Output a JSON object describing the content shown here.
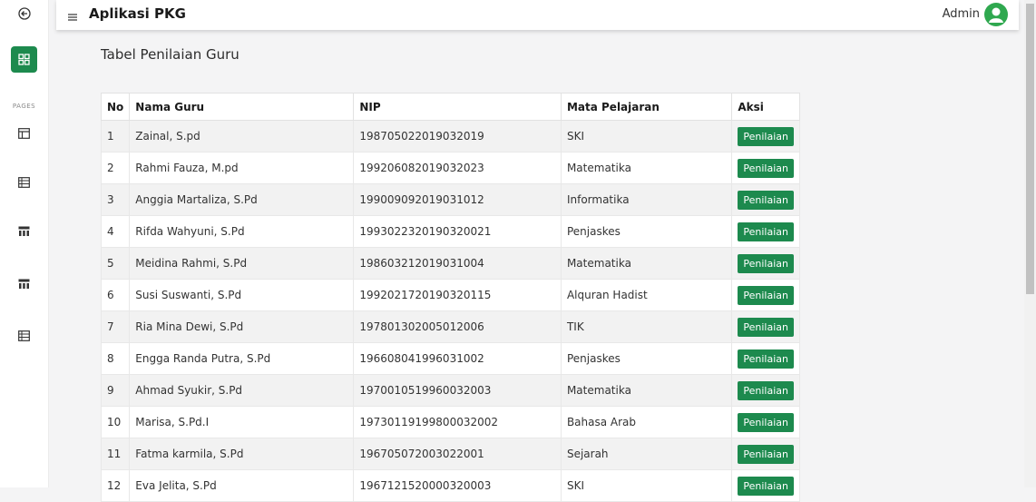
{
  "app": {
    "title": "Aplikasi PKG"
  },
  "header": {
    "user_label": "Admin"
  },
  "sidebar": {
    "section_label": "PAGES"
  },
  "page": {
    "heading": "Tabel Penilaian Guru"
  },
  "table": {
    "columns": [
      "No",
      "Nama Guru",
      "NIP",
      "Mata Pelajaran",
      "Aksi"
    ],
    "rows": [
      {
        "no": "1",
        "nama": "Zainal, S.pd",
        "nip": "198705022019032019",
        "mapel": "SKI",
        "aksi": "Penilaian"
      },
      {
        "no": "2",
        "nama": "Rahmi Fauza, M.pd",
        "nip": "199206082019032023",
        "mapel": "Matematika",
        "aksi": "Penilaian"
      },
      {
        "no": "3",
        "nama": "Anggia Martaliza, S.Pd",
        "nip": "199009092019031012",
        "mapel": "Informatika",
        "aksi": "Penilaian"
      },
      {
        "no": "4",
        "nama": "Rifda Wahyuni, S.Pd",
        "nip": "1993022320190320021",
        "mapel": "Penjaskes",
        "aksi": "Penilaian"
      },
      {
        "no": "5",
        "nama": "Meidina Rahmi, S.Pd",
        "nip": "198603212019031004",
        "mapel": "Matematika",
        "aksi": "Penilaian"
      },
      {
        "no": "6",
        "nama": "Susi Suswanti, S.Pd",
        "nip": "1992021720190320115",
        "mapel": "Alquran Hadist",
        "aksi": "Penilaian"
      },
      {
        "no": "7",
        "nama": "Ria Mina Dewi, S.Pd",
        "nip": "197801302005012006",
        "mapel": "TIK",
        "aksi": "Penilaian"
      },
      {
        "no": "8",
        "nama": "Engga Randa Putra, S.Pd",
        "nip": "196608041996031002",
        "mapel": "Penjaskes",
        "aksi": "Penilaian"
      },
      {
        "no": "9",
        "nama": "Ahmad Syukir, S.Pd",
        "nip": "1970010519960032003",
        "mapel": "Matematika",
        "aksi": "Penilaian"
      },
      {
        "no": "10",
        "nama": "Marisa, S.Pd.I",
        "nip": "19730119199800032002",
        "mapel": "Bahasa Arab",
        "aksi": "Penilaian"
      },
      {
        "no": "11",
        "nama": "Fatma karmila, S.Pd",
        "nip": "196705072003022001",
        "mapel": "Sejarah",
        "aksi": "Penilaian"
      },
      {
        "no": "12",
        "nama": "Eva Jelita, S.Pd",
        "nip": "1967121520000320003",
        "mapel": "SKI",
        "aksi": "Penilaian"
      }
    ]
  },
  "colors": {
    "accent": "#1d8a4e",
    "avatar": "#2fa84f"
  },
  "icons": {
    "back": "arrow-circle-icon",
    "dashboard": "dashboard-grid-icon",
    "menu": "hamburger-menu-icon",
    "user": "user-avatar-icon",
    "tables": [
      "table-icon",
      "table-list-icon",
      "table-layout-icon",
      "table-layout-icon",
      "table-list-icon"
    ]
  }
}
